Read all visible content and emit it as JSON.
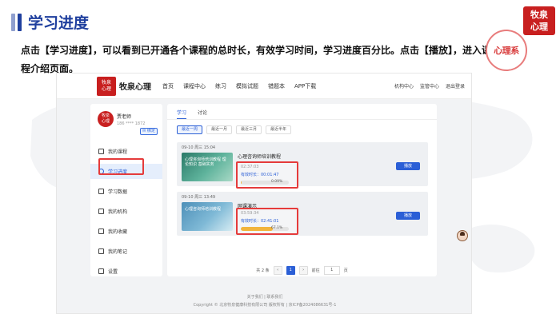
{
  "slide": {
    "title": "学习进度",
    "brand_lines": [
      "牧泉",
      "心理"
    ],
    "description": "点击【学习进度】，可以看到已开通各个课程的总时长，有效学习时间，学习进度百分比。点击【播放】，进入课程介绍页面。",
    "badge_text": "心理系"
  },
  "site": {
    "logo_lines": [
      "牧泉",
      "心理"
    ],
    "brand": "牧泉心理",
    "nav": [
      "首页",
      "课程中心",
      "练习",
      "模拟试题",
      "错题本",
      "APP下载"
    ],
    "nav_right": [
      "机构中心",
      "监管中心",
      "退出登录"
    ]
  },
  "profile": {
    "avatar_lines": [
      "牧泉",
      "心理"
    ],
    "name": "贾老师",
    "phone": "186 **** 1872",
    "bind_label": "✉ 绑定"
  },
  "menu": [
    {
      "label": "我的课程",
      "icon": "book-icon"
    },
    {
      "label": "学习进度",
      "icon": "clock-icon",
      "active": true
    },
    {
      "label": "学习数据",
      "icon": "chart-icon"
    },
    {
      "label": "我的机构",
      "icon": "building-icon"
    },
    {
      "label": "我的收藏",
      "icon": "star-icon"
    },
    {
      "label": "我的笔记",
      "icon": "note-icon"
    },
    {
      "label": "设置",
      "icon": "gear-icon"
    }
  ],
  "tabs": [
    "学习",
    "讨论"
  ],
  "filters": [
    "最近一周",
    "最近一月",
    "最近三月",
    "最近半年"
  ],
  "courses": [
    {
      "date": "09-10 周三 15:04",
      "thumb_caption": "心理咨询师培训教程 理论知识 基础实务",
      "title": "心理咨询师培训教程",
      "total": "02:37:03",
      "effective": "有效时长：00:01:47",
      "progress": 0.0009,
      "percent": "0.09%",
      "button": "播放"
    },
    {
      "date": "09-10 周三 13:49",
      "thumb_caption": "心理咨询师培训教程",
      "title": "网课演示",
      "total": "03:59:34",
      "effective": "有效时长：02:41:01",
      "progress": 0.671,
      "percent": "67.1%",
      "button": "播放"
    }
  ],
  "pager": {
    "total": "共 2 条",
    "prev": "‹",
    "current": "1",
    "next": "›",
    "goto": "前往",
    "input": "1",
    "page_unit": "页"
  },
  "footer": {
    "links": "关于我们 | 联系我们",
    "copyright": "Copyright © 北京牧泉健康科技有限公司 版权所有 | 京ICP备2024086631号-1"
  },
  "colors": {
    "accent": "#2b5fd6",
    "brand_red": "#c81f1f",
    "title_blue": "#1f3f9e",
    "highlight": "#e53b3b"
  }
}
